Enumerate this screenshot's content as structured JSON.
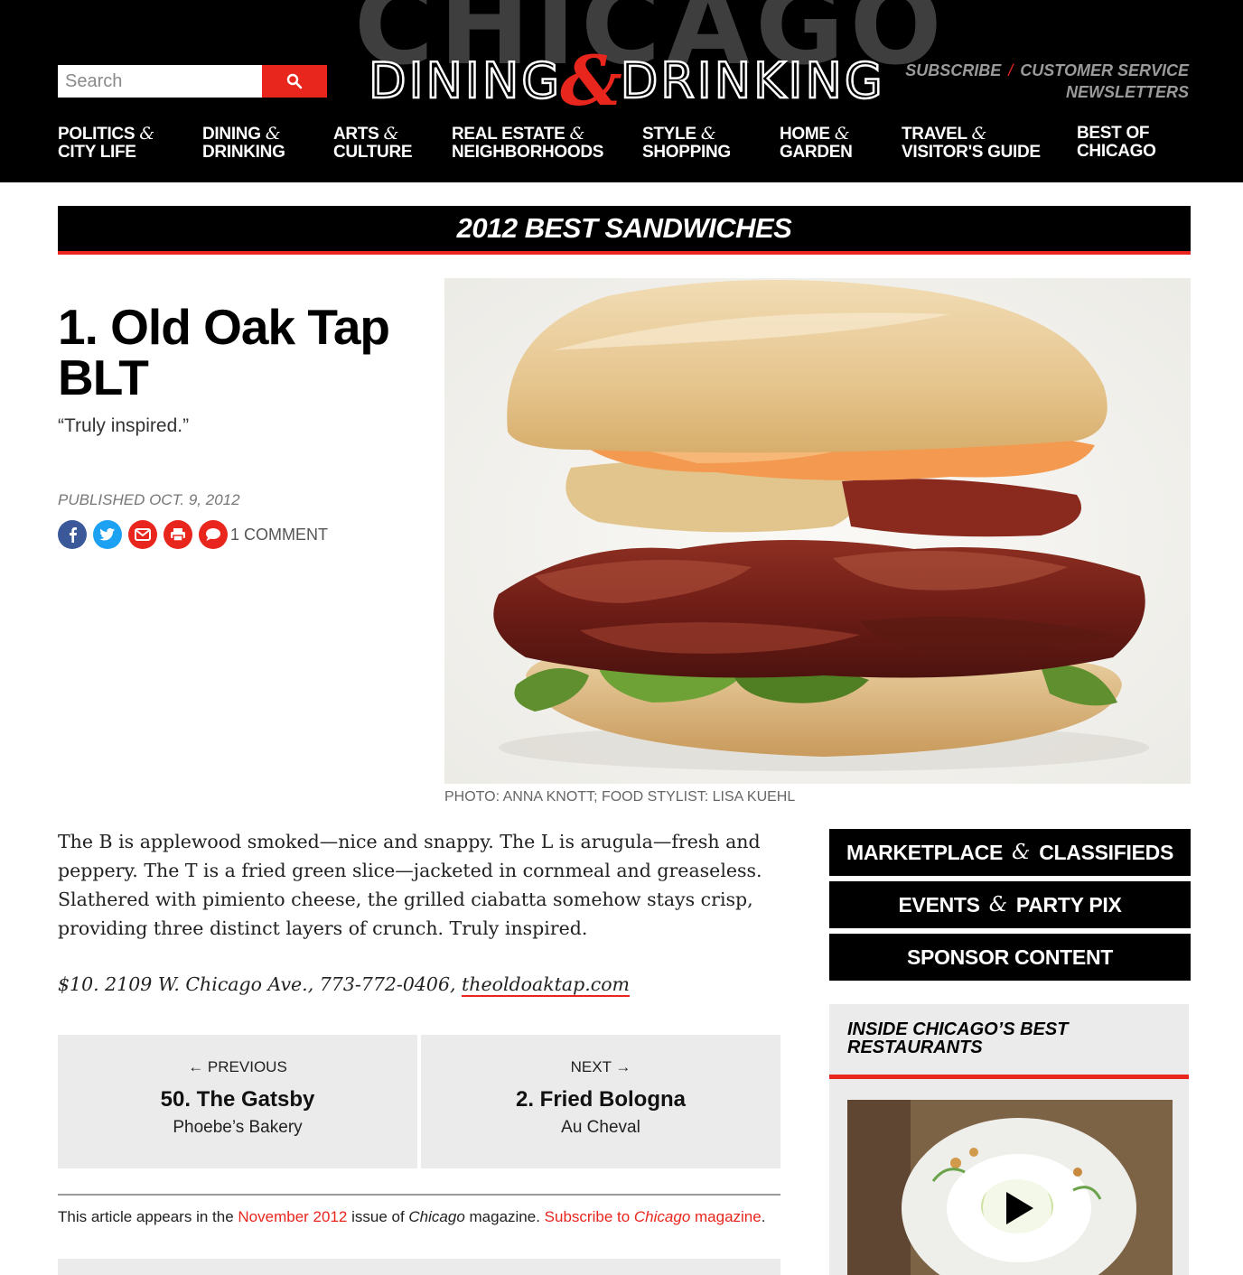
{
  "header": {
    "search_placeholder": "Search",
    "logo": {
      "background_word": "CHICAGO",
      "word1": "DINING",
      "amp": "&",
      "word2": "DRINKING"
    },
    "utility": {
      "subscribe": "SUBSCRIBE",
      "separator": "/",
      "customer_service": "CUSTOMER SERVICE",
      "newsletters": "NEWSLETTERS"
    },
    "nav": [
      {
        "l1": "POLITICS",
        "amp": "&",
        "l2": "CITY LIFE"
      },
      {
        "l1": "DINING",
        "amp": "&",
        "l2": "DRINKING"
      },
      {
        "l1": "ARTS",
        "amp": "&",
        "l2": "CULTURE"
      },
      {
        "l1": "REAL ESTATE",
        "amp": "&",
        "l2": "NEIGHBORHOODS"
      },
      {
        "l1": "STYLE",
        "amp": "&",
        "l2": "SHOPPING"
      },
      {
        "l1": "HOME",
        "amp": "&",
        "l2": "GARDEN"
      },
      {
        "l1": "TRAVEL",
        "amp": "&",
        "l2": "VISITOR'S GUIDE"
      },
      {
        "l1": "BEST OF",
        "amp": "",
        "l2": "CHICAGO"
      }
    ]
  },
  "section_title": "2012 BEST SANDWICHES",
  "article": {
    "title_line1": "1. Old Oak Tap",
    "title_line2": "BLT",
    "dek": "“Truly inspired.”",
    "published": "PUBLISHED OCT. 9, 2012",
    "comments": "1 COMMENT",
    "photo_credit": "PHOTO: ANNA KNOTT; FOOD STYLIST: LISA KUEHL",
    "body": "The B is applewood smoked—nice and snappy. The L is arugula—fresh and peppery. The T is a fried green slice—jacketed in cornmeal and greaseless. Slathered with pimiento cheese, the grilled ciabatta somehow stays crisp, providing three distinct layers of crunch. Truly inspired.",
    "info_prefix": "$10. 2109 W. Chicago Ave., 773-772-0406, ",
    "info_link": "theoldoaktap.com"
  },
  "pager": {
    "prev": {
      "dir": "← PREVIOUS",
      "title": "50. The Gatsby",
      "sub": "Phoebe’s Bakery"
    },
    "next": {
      "dir": "NEXT →",
      "title": "2. Fried Bologna",
      "sub": "Au Cheval"
    }
  },
  "appears": {
    "t1": "This article appears in the ",
    "issue": "November 2012",
    "t2": " issue of ",
    "mag": "Chicago",
    "t3": " magazine. ",
    "sub1": "Subscribe to ",
    "sub_mag": "Chicago",
    "sub2": " magazine",
    "end": "."
  },
  "sidebar": {
    "btn1": {
      "a": "MARKETPLACE",
      "amp": "&",
      "b": "CLASSIFIEDS"
    },
    "btn2": {
      "a": "EVENTS",
      "amp": "&",
      "b": "PARTY PIX"
    },
    "btn3": "SPONSOR CONTENT",
    "widget_title": "INSIDE CHICAGO’S BEST RESTAURANTS"
  },
  "colors": {
    "accent": "#e8261d",
    "header_bg": "#000000",
    "panel_bg": "#ebebeb",
    "facebook": "#3b5998",
    "twitter": "#1da1f2"
  },
  "icons": [
    "search-icon",
    "facebook-icon",
    "twitter-icon",
    "email-icon",
    "print-icon",
    "comment-icon",
    "play-icon"
  ]
}
